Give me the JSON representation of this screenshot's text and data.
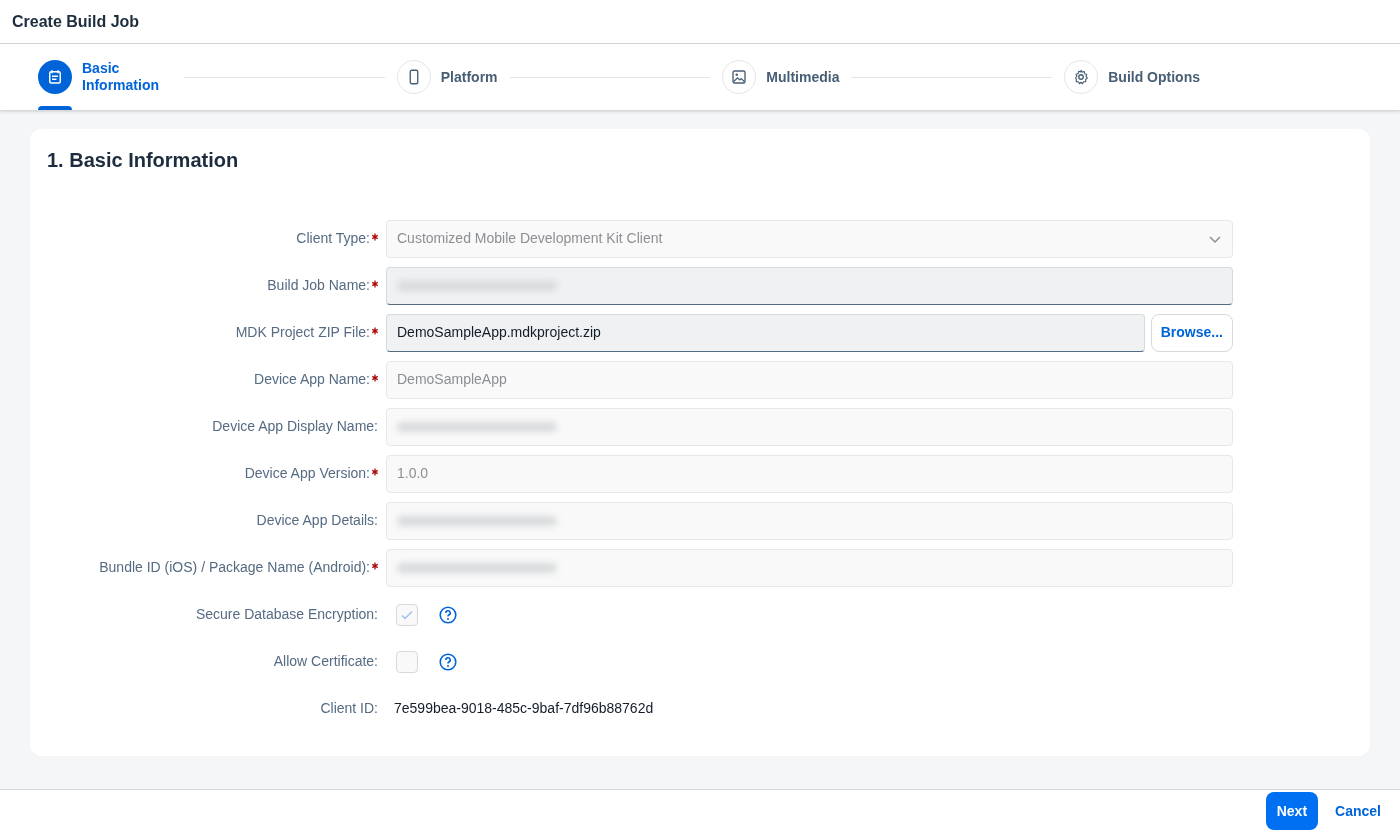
{
  "window": {
    "title": "Create Build Job"
  },
  "steps": [
    {
      "label": "Basic Information",
      "selected": true
    },
    {
      "label": "Platform",
      "selected": false
    },
    {
      "label": "Multimedia",
      "selected": false
    },
    {
      "label": "Build Options",
      "selected": false
    }
  ],
  "section": {
    "title": "1. Basic Information"
  },
  "fields": [
    {
      "kind": "select",
      "label": "Client Type:",
      "required": true,
      "disabled": true,
      "value": "Customized Mobile Development Kit Client"
    },
    {
      "kind": "input",
      "label": "Build Job Name:",
      "required": true,
      "disabled": false,
      "redacted": true
    },
    {
      "kind": "file",
      "label": "MDK Project ZIP File:",
      "required": true,
      "disabled": false,
      "value": "DemoSampleApp.mdkproject.zip",
      "button": "Browse..."
    },
    {
      "kind": "input",
      "label": "Device App Name:",
      "required": true,
      "disabled": true,
      "value": "DemoSampleApp"
    },
    {
      "kind": "input",
      "label": "Device App Display Name:",
      "required": false,
      "disabled": true,
      "redacted": true
    },
    {
      "kind": "input",
      "label": "Device App Version:",
      "required": true,
      "disabled": true,
      "value": "1.0.0"
    },
    {
      "kind": "input",
      "label": "Device App Details:",
      "required": false,
      "disabled": true,
      "redacted": true
    },
    {
      "kind": "input",
      "label": "Bundle ID (iOS) / Package Name (Android):",
      "required": true,
      "disabled": true,
      "redacted": true
    },
    {
      "kind": "checkbox",
      "label": "Secure Database Encryption:",
      "required": false,
      "disabled": true,
      "checked": true
    },
    {
      "kind": "checkbox",
      "label": "Allow Certificate:",
      "required": false,
      "disabled": true,
      "checked": false
    },
    {
      "kind": "text",
      "label": "Client ID:",
      "required": false,
      "value": "7e599bea-9018-485c-9baf-7df96b88762d"
    }
  ],
  "footer": {
    "buttons": [
      {
        "label": "Next",
        "kind": "primary"
      },
      {
        "label": "Cancel",
        "kind": "transparent"
      }
    ]
  }
}
